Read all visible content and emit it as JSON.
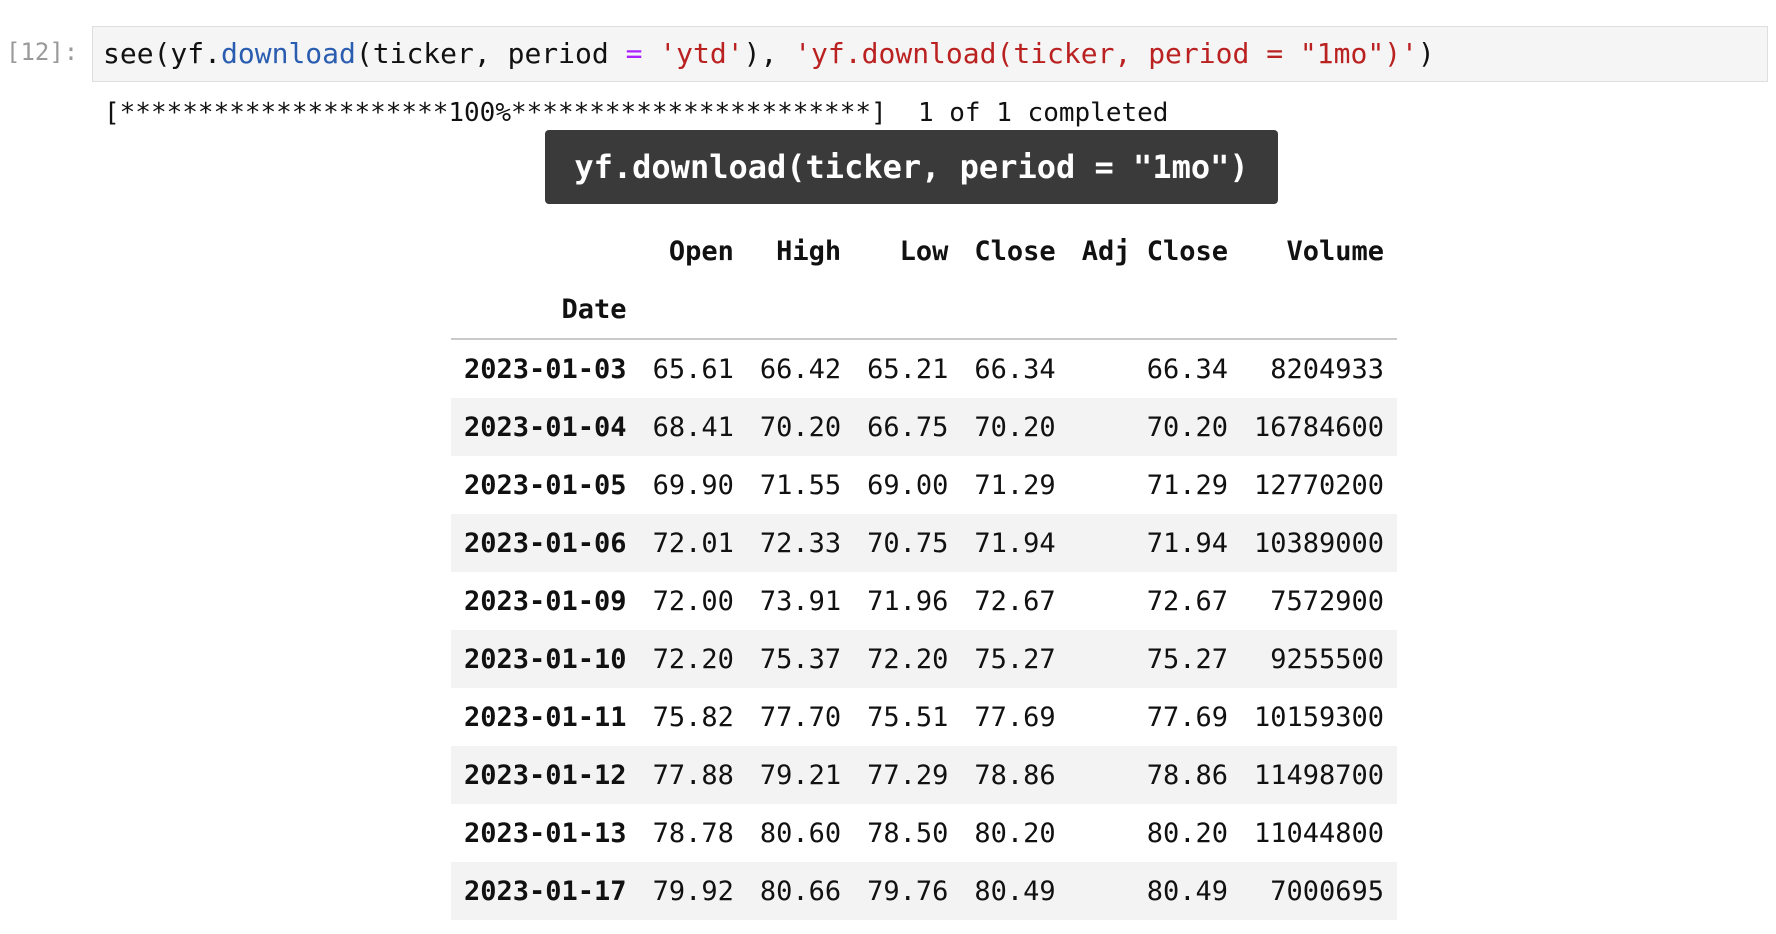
{
  "cell": {
    "prompt": "[12]:",
    "code_tokens": [
      {
        "text": "see(yf.",
        "kind": "plain"
      },
      {
        "text": "download",
        "kind": "fn"
      },
      {
        "text": "(ticker, period ",
        "kind": "plain"
      },
      {
        "text": "=",
        "kind": "op"
      },
      {
        "text": " ",
        "kind": "plain"
      },
      {
        "text": "'ytd'",
        "kind": "str"
      },
      {
        "text": "), ",
        "kind": "plain"
      },
      {
        "text": "'yf.download(ticker, period = \"1mo\")'",
        "kind": "str"
      },
      {
        "text": ")",
        "kind": "plain"
      }
    ],
    "colors": {
      "fn": "#2a5db0",
      "op": "#aa22ff",
      "str": "#ba2121",
      "input_bg": "#f5f5f5",
      "title_bg": "#3a3a3a"
    }
  },
  "output": {
    "progress_text": "[*********************100%***********************]  1 of 1 completed",
    "title": "yf.download(ticker, period = \"1mo\")",
    "table": {
      "columns": [
        "Open",
        "High",
        "Low",
        "Close",
        "Adj Close",
        "Volume"
      ],
      "index_name": "Date",
      "rows": [
        {
          "date": "2023-01-03",
          "values": [
            "65.61",
            "66.42",
            "65.21",
            "66.34",
            "66.34",
            "8204933"
          ]
        },
        {
          "date": "2023-01-04",
          "values": [
            "68.41",
            "70.20",
            "66.75",
            "70.20",
            "70.20",
            "16784600"
          ]
        },
        {
          "date": "2023-01-05",
          "values": [
            "69.90",
            "71.55",
            "69.00",
            "71.29",
            "71.29",
            "12770200"
          ]
        },
        {
          "date": "2023-01-06",
          "values": [
            "72.01",
            "72.33",
            "70.75",
            "71.94",
            "71.94",
            "10389000"
          ]
        },
        {
          "date": "2023-01-09",
          "values": [
            "72.00",
            "73.91",
            "71.96",
            "72.67",
            "72.67",
            "7572900"
          ]
        },
        {
          "date": "2023-01-10",
          "values": [
            "72.20",
            "75.37",
            "72.20",
            "75.27",
            "75.27",
            "9255500"
          ]
        },
        {
          "date": "2023-01-11",
          "values": [
            "75.82",
            "77.70",
            "75.51",
            "77.69",
            "77.69",
            "10159300"
          ]
        },
        {
          "date": "2023-01-12",
          "values": [
            "77.88",
            "79.21",
            "77.29",
            "78.86",
            "78.86",
            "11498700"
          ]
        },
        {
          "date": "2023-01-13",
          "values": [
            "78.78",
            "80.60",
            "78.50",
            "80.20",
            "80.20",
            "11044800"
          ]
        },
        {
          "date": "2023-01-17",
          "values": [
            "79.92",
            "80.66",
            "79.76",
            "80.49",
            "80.49",
            "7000695"
          ]
        }
      ]
    }
  }
}
